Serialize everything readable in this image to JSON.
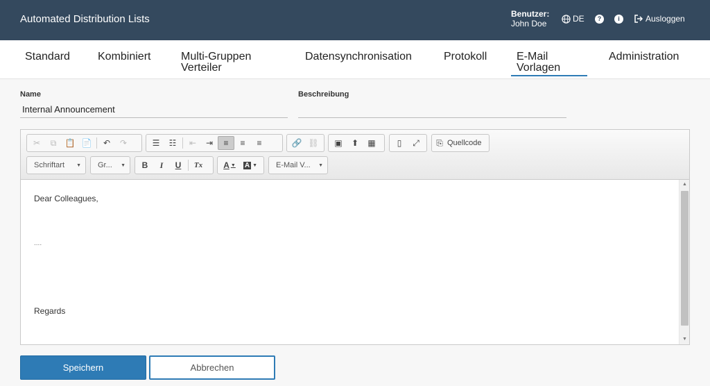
{
  "header": {
    "title": "Automated Distribution Lists",
    "user_label": "Benutzer:",
    "user_name": "John Doe",
    "language": "DE",
    "logout_label": "Ausloggen",
    "help_glyph": "?",
    "info_glyph": "i",
    "background_color": "#34495e"
  },
  "tabs": [
    {
      "label": "Standard"
    },
    {
      "label": "Kombiniert"
    },
    {
      "label": "Multi-Gruppen Verteiler"
    },
    {
      "label": "Datensynchronisation"
    },
    {
      "label": "Protokoll"
    },
    {
      "label": "E-Mail Vorlagen",
      "active": true
    },
    {
      "label": "Administration"
    }
  ],
  "form": {
    "name_label": "Name",
    "name_value": "Internal Announcement",
    "description_label": "Beschreibung",
    "description_value": ""
  },
  "toolbar": {
    "font_combo": "Schriftart",
    "size_combo": "Gr...",
    "bold_glyph": "B",
    "italic_glyph": "I",
    "underline_glyph": "U",
    "remove_format_glyph": "Tx",
    "text_color_glyph": "A",
    "bg_color_glyph": "A",
    "template_combo": "E-Mail V...",
    "source_label": "Quellcode"
  },
  "editor": {
    "lines": [
      "Dear Colleagues,",
      "....",
      "Regards"
    ]
  },
  "actions": {
    "save_label": "Speichern",
    "cancel_label": "Abbrechen",
    "accent_color": "#2e7bb5"
  }
}
